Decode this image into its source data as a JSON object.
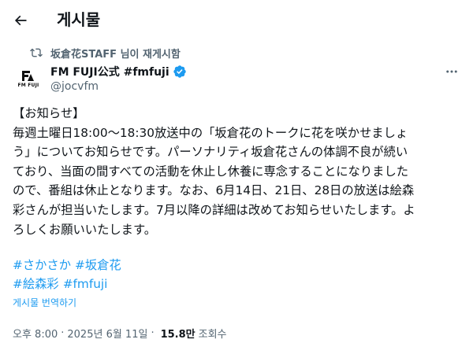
{
  "header": {
    "title": "게시물"
  },
  "repost": {
    "text": "坂倉花STAFF 님이 재게시함"
  },
  "author": {
    "name": "FM FUJI公式 #fmfuji",
    "handle": "@jocvfm",
    "avatar_label": "FM FUJI",
    "verified": true,
    "verified_color": "#1d9bf0"
  },
  "post": {
    "lines": [
      "【お知らせ】",
      "毎週土曜日18:00〜18:30放送中の「坂倉花のトークに花を咲かせましょ",
      "う」についてお知らせです。パーソナリティ坂倉花さんの体調不良が続い",
      "ており、当面の間すべての活動を休止し休養に専念することになりました",
      "ので、番組は休止となります。なお、6月14日、21日、28日の放送は絵森",
      "彩さんが担当いたします。7月以降の詳細は改めてお知らせいたします。よ",
      "ろしくお願いいたします。"
    ],
    "hashtags": [
      "#さかさか",
      "#坂倉花",
      "#絵森彩",
      "#fmfuji"
    ],
    "translate_label": "게시물 번역하기"
  },
  "meta": {
    "time": "오후 8:00",
    "separator": "·",
    "date": "2025년 6월 11일",
    "views": "15.8만",
    "views_label": "조회수"
  },
  "colors": {
    "text": "#0f1419",
    "secondary": "#536471",
    "link": "#1d9bf0",
    "background": "#ffffff"
  }
}
